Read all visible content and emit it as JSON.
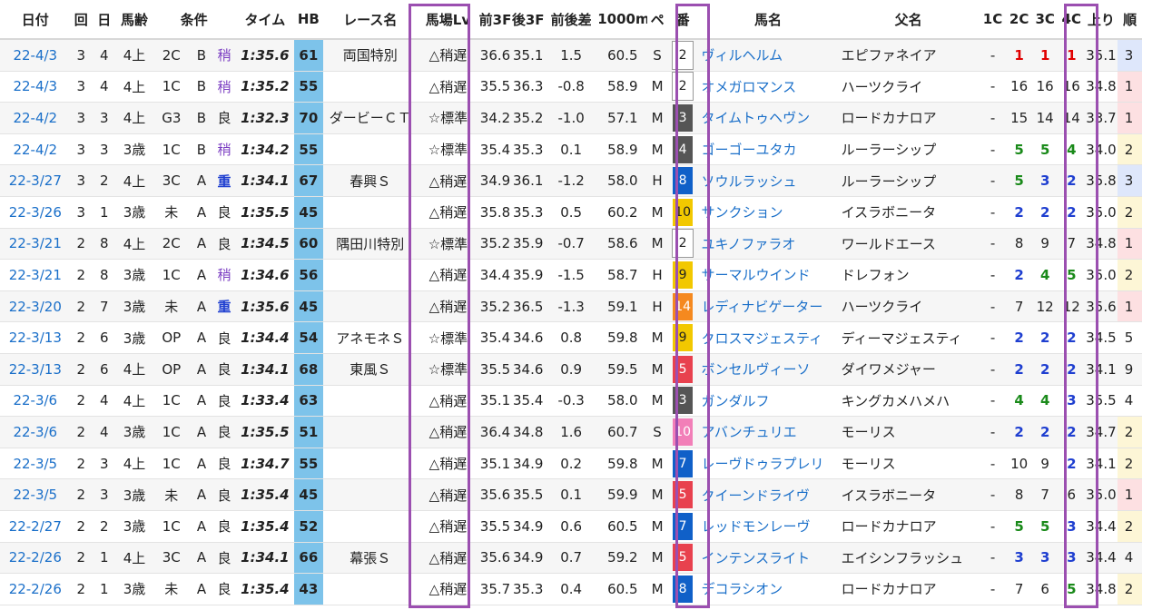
{
  "headers": {
    "date": "日付",
    "kai": "回",
    "day": "日",
    "age": "馬齢",
    "cond": "条件",
    "time": "タイム",
    "hb": "HB",
    "race": "レース名",
    "lv": "馬場Lv",
    "f3": "前3F",
    "l3": "後3F",
    "diff": "前後差",
    "t1000": "1000m",
    "pace": "ペ",
    "ban": "番",
    "horse": "馬名",
    "sire": "父名",
    "c1": "1C",
    "c2": "2C",
    "c3": "3C",
    "c4": "4C",
    "agari": "上り",
    "jun": "順"
  },
  "rows": [
    {
      "date": "22-4/3",
      "kai": "3",
      "day": "4",
      "age": "4上",
      "cond": "2C",
      "grade": "B",
      "fm": "稍",
      "time": "1:35.6",
      "hb": "61",
      "race": "両国特別",
      "lv": "△稍遅",
      "f3": "36.6",
      "l3": "35.1",
      "diff": "1.5",
      "t1000": "60.5",
      "pace": "S",
      "ban": "2",
      "horse": "ヴィルヘルム",
      "sire": "エピファネイア",
      "c1": "-",
      "c2": "1",
      "c3": "1",
      "c4": "1",
      "agari": "35.1",
      "jun": "3"
    },
    {
      "date": "22-4/3",
      "kai": "3",
      "day": "4",
      "age": "4上",
      "cond": "1C",
      "grade": "B",
      "fm": "稍",
      "time": "1:35.2",
      "hb": "55",
      "race": "",
      "lv": "△稍遅",
      "f3": "35.5",
      "l3": "36.3",
      "diff": "-0.8",
      "t1000": "58.9",
      "pace": "M",
      "ban": "2",
      "horse": "オメガロマンス",
      "sire": "ハーツクライ",
      "c1": "-",
      "c2": "16",
      "c3": "16",
      "c4": "16",
      "agari": "34.8",
      "jun": "1"
    },
    {
      "date": "22-4/2",
      "kai": "3",
      "day": "3",
      "age": "4上",
      "cond": "G3",
      "grade": "B",
      "fm": "良",
      "time": "1:32.3",
      "hb": "70",
      "race": "ダービーＣＴ",
      "lv": "☆標準",
      "f3": "34.2",
      "l3": "35.2",
      "diff": "-1.0",
      "t1000": "57.1",
      "pace": "M",
      "ban": "3",
      "horse": "タイムトゥヘヴン",
      "sire": "ロードカナロア",
      "c1": "-",
      "c2": "15",
      "c3": "14",
      "c4": "14",
      "agari": "33.7",
      "jun": "1"
    },
    {
      "date": "22-4/2",
      "kai": "3",
      "day": "3",
      "age": "3歳",
      "cond": "1C",
      "grade": "B",
      "fm": "稍",
      "time": "1:34.2",
      "hb": "55",
      "race": "",
      "lv": "☆標準",
      "f3": "35.4",
      "l3": "35.3",
      "diff": "0.1",
      "t1000": "58.9",
      "pace": "M",
      "ban": "4",
      "horse": "ゴーゴーユタカ",
      "sire": "ルーラーシップ",
      "c1": "-",
      "c2": "5",
      "c3": "5",
      "c4": "4",
      "agari": "34.0",
      "jun": "2"
    },
    {
      "date": "22-3/27",
      "kai": "3",
      "day": "2",
      "age": "4上",
      "cond": "3C",
      "grade": "A",
      "fm": "重",
      "time": "1:34.1",
      "hb": "67",
      "race": "春興Ｓ",
      "lv": "△稍遅",
      "f3": "34.9",
      "l3": "36.1",
      "diff": "-1.2",
      "t1000": "58.0",
      "pace": "H",
      "ban": "8",
      "horse": "ソウルラッシュ",
      "sire": "ルーラーシップ",
      "c1": "-",
      "c2": "5",
      "c3": "3",
      "c4": "2",
      "agari": "35.8",
      "jun": "3"
    },
    {
      "date": "22-3/26",
      "kai": "3",
      "day": "1",
      "age": "3歳",
      "cond": "未",
      "grade": "A",
      "fm": "良",
      "time": "1:35.5",
      "hb": "45",
      "race": "",
      "lv": "△稍遅",
      "f3": "35.8",
      "l3": "35.3",
      "diff": "0.5",
      "t1000": "60.2",
      "pace": "M",
      "ban": "10",
      "horse": "サンクション",
      "sire": "イスラボニータ",
      "c1": "-",
      "c2": "2",
      "c3": "2",
      "c4": "2",
      "agari": "35.0",
      "jun": "2"
    },
    {
      "date": "22-3/21",
      "kai": "2",
      "day": "8",
      "age": "4上",
      "cond": "2C",
      "grade": "A",
      "fm": "良",
      "time": "1:34.5",
      "hb": "60",
      "race": "隅田川特別",
      "lv": "☆標準",
      "f3": "35.2",
      "l3": "35.9",
      "diff": "-0.7",
      "t1000": "58.6",
      "pace": "M",
      "ban": "2",
      "horse": "ユキノファラオ",
      "sire": "ワールドエース",
      "c1": "-",
      "c2": "8",
      "c3": "9",
      "c4": "7",
      "agari": "34.8",
      "jun": "1"
    },
    {
      "date": "22-3/21",
      "kai": "2",
      "day": "8",
      "age": "3歳",
      "cond": "1C",
      "grade": "A",
      "fm": "稍",
      "time": "1:34.6",
      "hb": "56",
      "race": "",
      "lv": "△稍遅",
      "f3": "34.4",
      "l3": "35.9",
      "diff": "-1.5",
      "t1000": "58.7",
      "pace": "H",
      "ban": "9",
      "horse": "サーマルウインド",
      "sire": "ドレフォン",
      "c1": "-",
      "c2": "2",
      "c3": "4",
      "c4": "5",
      "agari": "35.0",
      "jun": "2"
    },
    {
      "date": "22-3/20",
      "kai": "2",
      "day": "7",
      "age": "3歳",
      "cond": "未",
      "grade": "A",
      "fm": "重",
      "time": "1:35.6",
      "hb": "45",
      "race": "",
      "lv": "△稍遅",
      "f3": "35.2",
      "l3": "36.5",
      "diff": "-1.3",
      "t1000": "59.1",
      "pace": "H",
      "ban": "14",
      "horse": "レディナビゲーター",
      "sire": "ハーツクライ",
      "c1": "-",
      "c2": "7",
      "c3": "12",
      "c4": "12",
      "agari": "35.6",
      "jun": "1"
    },
    {
      "date": "22-3/13",
      "kai": "2",
      "day": "6",
      "age": "3歳",
      "cond": "OP",
      "grade": "A",
      "fm": "良",
      "time": "1:34.4",
      "hb": "54",
      "race": "アネモネＳ",
      "lv": "☆標準",
      "f3": "35.4",
      "l3": "34.6",
      "diff": "0.8",
      "t1000": "59.8",
      "pace": "M",
      "ban": "9",
      "horse": "クロスマジェスティ",
      "sire": "ディーマジェスティ",
      "c1": "-",
      "c2": "2",
      "c3": "2",
      "c4": "2",
      "agari": "34.5",
      "jun": "5"
    },
    {
      "date": "22-3/13",
      "kai": "2",
      "day": "6",
      "age": "4上",
      "cond": "OP",
      "grade": "A",
      "fm": "良",
      "time": "1:34.1",
      "hb": "68",
      "race": "東風Ｓ",
      "lv": "☆標準",
      "f3": "35.5",
      "l3": "34.6",
      "diff": "0.9",
      "t1000": "59.5",
      "pace": "M",
      "ban": "5",
      "horse": "ボンセルヴィーソ",
      "sire": "ダイワメジャー",
      "c1": "-",
      "c2": "2",
      "c3": "2",
      "c4": "2",
      "agari": "34.1",
      "jun": "9"
    },
    {
      "date": "22-3/6",
      "kai": "2",
      "day": "4",
      "age": "4上",
      "cond": "1C",
      "grade": "A",
      "fm": "良",
      "time": "1:33.4",
      "hb": "63",
      "race": "",
      "lv": "△稍遅",
      "f3": "35.1",
      "l3": "35.4",
      "diff": "-0.3",
      "t1000": "58.0",
      "pace": "M",
      "ban": "3",
      "horse": "ガンダルフ",
      "sire": "キングカメハメハ",
      "c1": "-",
      "c2": "4",
      "c3": "4",
      "c4": "3",
      "agari": "35.5",
      "jun": "4"
    },
    {
      "date": "22-3/6",
      "kai": "2",
      "day": "4",
      "age": "3歳",
      "cond": "1C",
      "grade": "A",
      "fm": "良",
      "time": "1:35.5",
      "hb": "51",
      "race": "",
      "lv": "△稍遅",
      "f3": "36.4",
      "l3": "34.8",
      "diff": "1.6",
      "t1000": "60.7",
      "pace": "S",
      "ban": "10",
      "horse": "アバンチュリエ",
      "sire": "モーリス",
      "c1": "-",
      "c2": "2",
      "c3": "2",
      "c4": "2",
      "agari": "34.7",
      "jun": "2"
    },
    {
      "date": "22-3/5",
      "kai": "2",
      "day": "3",
      "age": "4上",
      "cond": "1C",
      "grade": "A",
      "fm": "良",
      "time": "1:34.7",
      "hb": "55",
      "race": "",
      "lv": "△稍遅",
      "f3": "35.1",
      "l3": "34.9",
      "diff": "0.2",
      "t1000": "59.8",
      "pace": "M",
      "ban": "7",
      "horse": "レーヴドゥラプレリ",
      "sire": "モーリス",
      "c1": "-",
      "c2": "10",
      "c3": "9",
      "c4": "2",
      "agari": "34.1",
      "jun": "2"
    },
    {
      "date": "22-3/5",
      "kai": "2",
      "day": "3",
      "age": "3歳",
      "cond": "未",
      "grade": "A",
      "fm": "良",
      "time": "1:35.4",
      "hb": "45",
      "race": "",
      "lv": "△稍遅",
      "f3": "35.6",
      "l3": "35.5",
      "diff": "0.1",
      "t1000": "59.9",
      "pace": "M",
      "ban": "5",
      "horse": "クイーンドライヴ",
      "sire": "イスラボニータ",
      "c1": "-",
      "c2": "8",
      "c3": "7",
      "c4": "6",
      "agari": "35.0",
      "jun": "1"
    },
    {
      "date": "22-2/27",
      "kai": "2",
      "day": "2",
      "age": "3歳",
      "cond": "1C",
      "grade": "A",
      "fm": "良",
      "time": "1:35.4",
      "hb": "52",
      "race": "",
      "lv": "△稍遅",
      "f3": "35.5",
      "l3": "34.9",
      "diff": "0.6",
      "t1000": "60.5",
      "pace": "M",
      "ban": "7",
      "horse": "レッドモンレーヴ",
      "sire": "ロードカナロア",
      "c1": "-",
      "c2": "5",
      "c3": "5",
      "c4": "3",
      "agari": "34.4",
      "jun": "2"
    },
    {
      "date": "22-2/26",
      "kai": "2",
      "day": "1",
      "age": "4上",
      "cond": "3C",
      "grade": "A",
      "fm": "良",
      "time": "1:34.1",
      "hb": "66",
      "race": "幕張Ｓ",
      "lv": "△稍遅",
      "f3": "35.6",
      "l3": "34.9",
      "diff": "0.7",
      "t1000": "59.2",
      "pace": "M",
      "ban": "5",
      "horse": "インテンスライト",
      "sire": "エイシンフラッシュ",
      "c1": "-",
      "c2": "3",
      "c3": "3",
      "c4": "3",
      "agari": "34.4",
      "jun": "4"
    },
    {
      "date": "22-2/26",
      "kai": "2",
      "day": "1",
      "age": "3歳",
      "cond": "未",
      "grade": "A",
      "fm": "良",
      "time": "1:35.4",
      "hb": "43",
      "race": "",
      "lv": "△稍遅",
      "f3": "35.7",
      "l3": "35.3",
      "diff": "0.4",
      "t1000": "60.5",
      "pace": "M",
      "ban": "8",
      "horse": "デコラシオン",
      "sire": "ロードカナロア",
      "c1": "-",
      "c2": "7",
      "c3": "6",
      "c4": "5",
      "agari": "34.8",
      "jun": "2"
    }
  ],
  "colors": {
    "accent": "#9b4fb0",
    "hb_bg": "#7dc3ea",
    "link": "#1a6fc9",
    "gate": {
      "1": {
        "bg": "#ffffff",
        "fg": "#222222"
      },
      "2": {
        "bg": "#555555",
        "fg": "#ffffff"
      },
      "3": {
        "bg": "#e8414e",
        "fg": "#ffffff"
      },
      "4": {
        "bg": "#1060c8",
        "fg": "#ffffff"
      },
      "5": {
        "bg": "#f2c800",
        "fg": "#222222"
      },
      "6": {
        "bg": "#2e9a3c",
        "fg": "#ffffff"
      },
      "7": {
        "bg": "#f5891f",
        "fg": "#ffffff"
      },
      "8": {
        "bg": "#f27fb8",
        "fg": "#ffffff"
      }
    }
  },
  "gate_of_row": [
    1,
    1,
    2,
    2,
    4,
    5,
    1,
    5,
    7,
    5,
    3,
    2,
    8,
    4,
    3,
    4,
    3,
    4
  ]
}
